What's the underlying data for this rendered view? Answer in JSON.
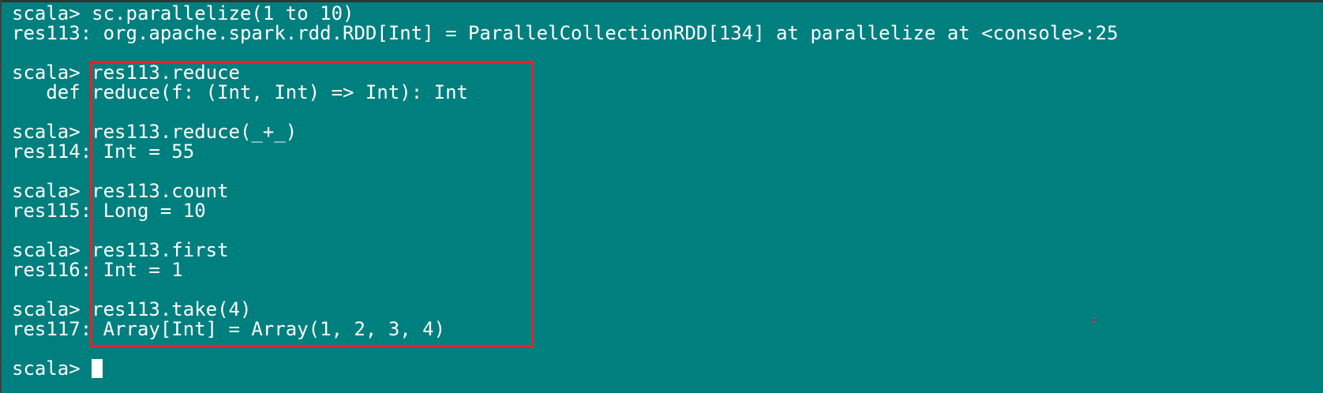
{
  "terminal": {
    "lines": [
      "scala> sc.parallelize(1 to 10)",
      "res113: org.apache.spark.rdd.RDD[Int] = ParallelCollectionRDD[134] at parallelize at <console>:25",
      "",
      "scala> res113.reduce",
      "   def reduce(f: (Int, Int) => Int): Int",
      "",
      "scala> res113.reduce(_+_)",
      "res114: Int = 55",
      "",
      "scala> res113.count",
      "res115: Long = 10",
      "",
      "scala> res113.first",
      "res116: Int = 1",
      "",
      "scala> res113.take(4)",
      "res117: Array[Int] = Array(1, 2, 3, 4)",
      "",
      "scala> "
    ]
  },
  "colors": {
    "background": "#007f7f",
    "text": "#ffffff",
    "highlight": "#e8202a"
  }
}
